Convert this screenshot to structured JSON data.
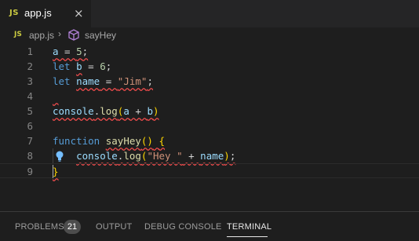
{
  "tab": {
    "icon_label": "JS",
    "title": "app.js",
    "close_icon": "×"
  },
  "breadcrumb": {
    "icon_label": "JS",
    "file": "app.js",
    "separator": "›",
    "symbol_icon": "cube-icon",
    "function": "sayHey"
  },
  "editor": {
    "line_numbers": [
      "1",
      "2",
      "3",
      "4",
      "5",
      "6",
      "7",
      "8",
      "9"
    ],
    "lines": [
      [
        {
          "t": "a",
          "c": "var"
        },
        {
          "t": " = ",
          "c": ""
        },
        {
          "t": "5",
          "c": "num"
        },
        {
          "t": ";",
          "c": ""
        }
      ],
      [
        {
          "t": "let",
          "c": "kw"
        },
        {
          "t": " ",
          "c": ""
        },
        {
          "t": "b",
          "c": "var"
        },
        {
          "t": " = ",
          "c": ""
        },
        {
          "t": "6",
          "c": "num"
        },
        {
          "t": ";",
          "c": ""
        }
      ],
      [
        {
          "t": "let",
          "c": "kw"
        },
        {
          "t": " ",
          "c": ""
        },
        {
          "t": "name",
          "c": "var"
        },
        {
          "t": " = ",
          "c": ""
        },
        {
          "t": "\"Jim\"",
          "c": "str"
        },
        {
          "t": ";",
          "c": ""
        }
      ],
      [],
      [
        {
          "t": "console",
          "c": "var"
        },
        {
          "t": ".",
          "c": ""
        },
        {
          "t": "log",
          "c": "fn"
        },
        {
          "t": "(",
          "c": "brk"
        },
        {
          "t": "a",
          "c": "var"
        },
        {
          "t": " + ",
          "c": ""
        },
        {
          "t": "b",
          "c": "var"
        },
        {
          "t": ")",
          "c": "brk"
        }
      ],
      [],
      [
        {
          "t": "function",
          "c": "kw"
        },
        {
          "t": " ",
          "c": ""
        },
        {
          "t": "sayHey",
          "c": "fn"
        },
        {
          "t": "()",
          "c": "brk"
        },
        {
          "t": " ",
          "c": ""
        },
        {
          "t": "{",
          "c": "brk"
        }
      ],
      [
        {
          "t": "    ",
          "c": ""
        },
        {
          "t": "console",
          "c": "var"
        },
        {
          "t": ".",
          "c": ""
        },
        {
          "t": "log",
          "c": "fn"
        },
        {
          "t": "(",
          "c": "brk"
        },
        {
          "t": "\"Hey \"",
          "c": "str"
        },
        {
          "t": " + ",
          "c": ""
        },
        {
          "t": "name",
          "c": "var"
        },
        {
          "t": ")",
          "c": "brk"
        },
        {
          "t": ";",
          "c": ""
        }
      ],
      [
        {
          "t": "}",
          "c": "brk"
        }
      ]
    ],
    "lightbulb_icon": "lightbulb-icon"
  },
  "panel": {
    "tabs": [
      {
        "label": "PROBLEMS",
        "active": false
      },
      {
        "label": "OUTPUT",
        "active": false
      },
      {
        "label": "DEBUG CONSOLE",
        "active": false
      },
      {
        "label": "TERMINAL",
        "active": true
      }
    ],
    "problems_count": "21"
  }
}
